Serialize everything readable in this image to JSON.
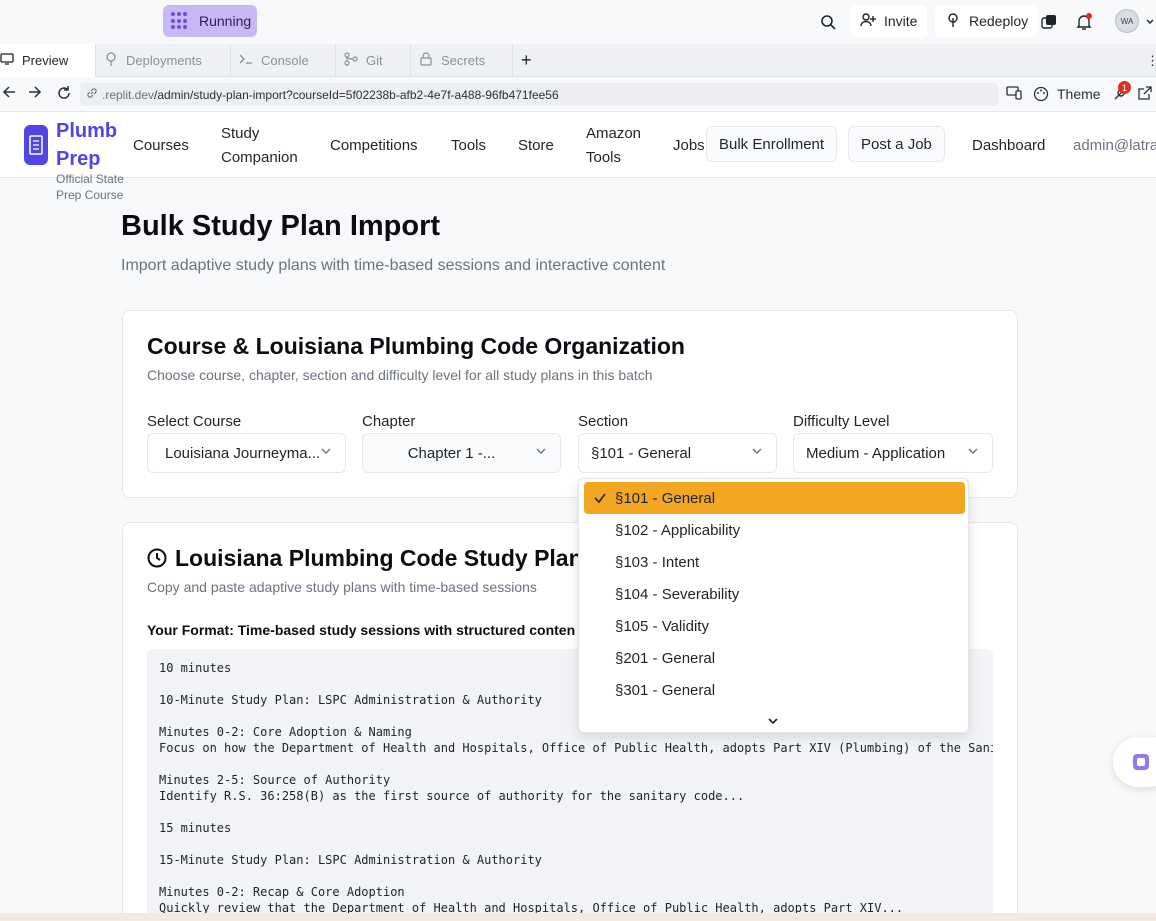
{
  "replit": {
    "run_label": "Running",
    "invite_label": "Invite",
    "redeploy_label": "Redeploy",
    "avatar_initials": "WA",
    "notification_count": "1",
    "tabs": [
      {
        "label": "Preview",
        "icon": "monitor-icon"
      },
      {
        "label": "Deployments",
        "icon": "deploy-icon"
      },
      {
        "label": "Console",
        "icon": "terminal-icon"
      },
      {
        "label": "Git",
        "icon": "git-icon"
      },
      {
        "label": "Secrets",
        "icon": "lock-icon"
      }
    ],
    "url_domain": ".replit.dev",
    "url_path": "/admin/study-plan-import?courseId=5f02238b-afb2-4e7f-a488-96fb471fee56",
    "theme_label": "Theme"
  },
  "site": {
    "logo_line1": "Plumb",
    "logo_line2": "Prep",
    "logo_sub": "Official State Prep Course",
    "nav": {
      "courses": "Courses",
      "study_1": "Study",
      "study_2": "Companion",
      "competitions": "Competitions",
      "tools": "Tools",
      "store": "Store",
      "amazon_1": "Amazon",
      "amazon_2": "Tools",
      "jobs": "Jobs",
      "bulk": "Bulk Enrollment",
      "post": "Post a Job",
      "dashboard": "Dashboard",
      "user": "admin@latra"
    }
  },
  "main": {
    "title": "Bulk Study Plan Import",
    "subtitle": "Import adaptive study plans with time-based sessions and interactive content",
    "org_card": {
      "title": "Course & Louisiana Plumbing Code Organization",
      "subtitle": "Choose course, chapter, section and difficulty level for all study plans in this batch",
      "course_label": "Select Course",
      "course_value": "Louisiana Journeyma...",
      "chapter_label": "Chapter",
      "chapter_value": "Chapter 1 -...",
      "section_label": "Section",
      "section_value": "§101 - General",
      "difficulty_label": "Difficulty Level",
      "difficulty_value": "Medium - Application"
    },
    "import_card": {
      "title": "Louisiana Plumbing Code Study Plan F",
      "subtitle": "Copy and paste adaptive study plans with time-based sessions",
      "format_label": "Your Format: Time-based study sessions with structured conten",
      "code_lines": [
        "10 minutes",
        "",
        "10-Minute Study Plan: LSPC Administration & Authority",
        "",
        "Minutes 0-2: Core Adoption & Naming",
        "Focus on how the Department of Health and Hospitals, Office of Public Health, adopts Part XIV (Plumbing) of the Sanitary Code...",
        "",
        "Minutes 2-5: Source of Authority",
        "Identify R.S. 36:258(B) as the first source of authority for the sanitary code...",
        "",
        "15 minutes",
        "",
        "15-Minute Study Plan: LSPC Administration & Authority",
        "",
        "Minutes 0-2: Recap & Core Adoption",
        "Quickly review that the Department of Health and Hospitals, Office of Public Health, adopts Part XIV..."
      ]
    }
  },
  "section_dropdown": {
    "options": [
      "§101 - General",
      "§102 - Applicability",
      "§103 - Intent",
      "§104 - Severability",
      "§105 - Validity",
      "§201 - General",
      "§301 - General"
    ],
    "selected": "§101 - General"
  },
  "colors": {
    "brand": "#4f46e5",
    "selected_option": "#f2a622",
    "running_badge": "#c9b8f5"
  }
}
